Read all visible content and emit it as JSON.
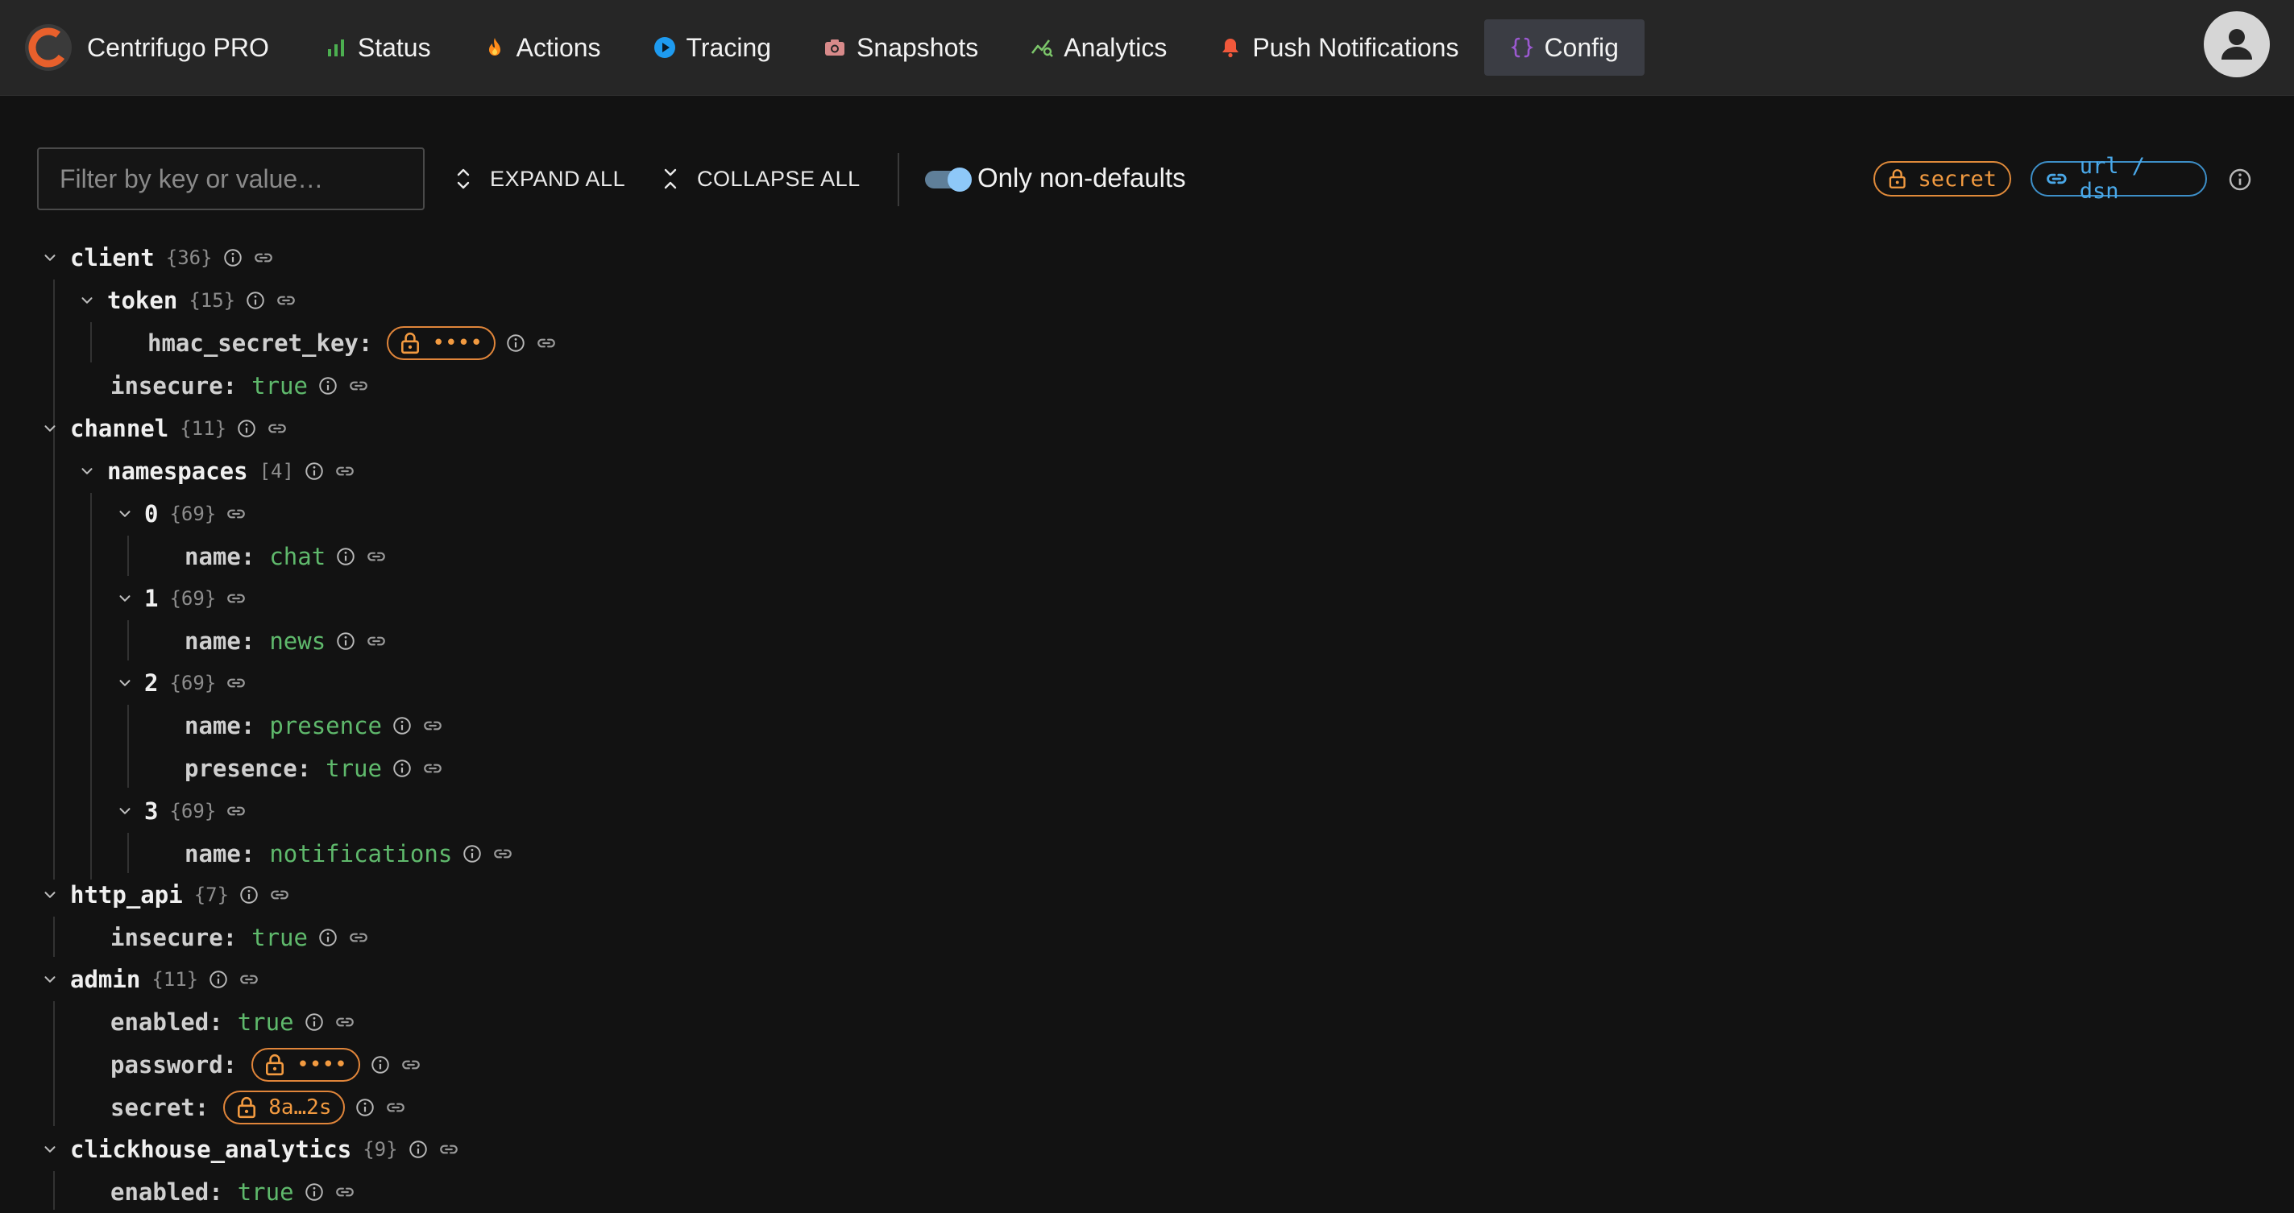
{
  "app": {
    "name": "Centrifugo PRO",
    "accent": "#e8602c"
  },
  "nav": {
    "items": [
      {
        "label": "Status",
        "icon": "bar-chart-icon"
      },
      {
        "label": "Actions",
        "icon": "flame-icon"
      },
      {
        "label": "Tracing",
        "icon": "play-circle-icon"
      },
      {
        "label": "Snapshots",
        "icon": "camera-icon"
      },
      {
        "label": "Analytics",
        "icon": "analytics-icon"
      },
      {
        "label": "Push Notifications",
        "icon": "bell-icon"
      },
      {
        "label": "Config",
        "icon": "braces-icon"
      }
    ],
    "active": "Config"
  },
  "toolbar": {
    "filter_placeholder": "Filter by key or value…",
    "expand_all": "EXPAND ALL",
    "collapse_all": "COLLAPSE ALL",
    "toggle_label": "Only non-defaults",
    "toggle_on": true
  },
  "legend": {
    "secret": "secret",
    "url": "url / dsn"
  },
  "colors": {
    "value_green": "#5fb96c",
    "secret_orange": "#f29a40",
    "url_blue": "#4aa8e8",
    "background": "#121212",
    "topbar": "#262626"
  },
  "tree": {
    "client": {
      "key": "client",
      "count": "{36}"
    },
    "token": {
      "key": "token",
      "count": "{15}"
    },
    "hmac_secret_key": {
      "key": "hmac_secret_key:",
      "value": "••••"
    },
    "client_insecure": {
      "key": "insecure:",
      "value": "true"
    },
    "channel": {
      "key": "channel",
      "count": "{11}"
    },
    "namespaces": {
      "key": "namespaces",
      "count": "[4]"
    },
    "ns0": {
      "key": "0",
      "count": "{69}"
    },
    "ns0_name": {
      "key": "name:",
      "value": "chat"
    },
    "ns1": {
      "key": "1",
      "count": "{69}"
    },
    "ns1_name": {
      "key": "name:",
      "value": "news"
    },
    "ns2": {
      "key": "2",
      "count": "{69}"
    },
    "ns2_name": {
      "key": "name:",
      "value": "presence"
    },
    "ns2_presence": {
      "key": "presence:",
      "value": "true"
    },
    "ns3": {
      "key": "3",
      "count": "{69}"
    },
    "ns3_name": {
      "key": "name:",
      "value": "notifications"
    },
    "http_api": {
      "key": "http_api",
      "count": "{7}"
    },
    "http_api_insecure": {
      "key": "insecure:",
      "value": "true"
    },
    "admin": {
      "key": "admin",
      "count": "{11}"
    },
    "admin_enabled": {
      "key": "enabled:",
      "value": "true"
    },
    "admin_password": {
      "key": "password:",
      "value": "••••"
    },
    "admin_secret": {
      "key": "secret:",
      "value": "8a…2s"
    },
    "clickhouse_analytics": {
      "key": "clickhouse_analytics",
      "count": "{9}"
    },
    "ch_enabled": {
      "key": "enabled:",
      "value": "true"
    }
  }
}
